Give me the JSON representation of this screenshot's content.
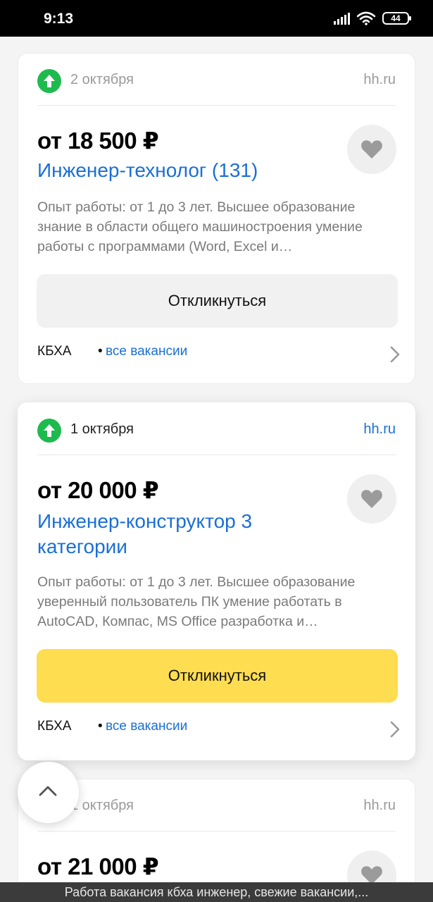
{
  "status_bar": {
    "time": "9:13",
    "battery": "44"
  },
  "cards": [
    {
      "date": "2 октября",
      "source": "hh.ru",
      "salary": "от 18 500 ₽",
      "title": "Инженер-технолог (131)",
      "description": "Опыт работы: от 1 до 3 лет. Высшее образование знание в области общего машиностроения умение работы с программами (Word, Excel и…",
      "apply_label": "Откликнуться",
      "company": "КБХА",
      "separator": "•",
      "all_vacancies": "все вакансии"
    },
    {
      "date": "1 октября",
      "source": "hh.ru",
      "salary": "от 20 000 ₽",
      "title": "Инженер-конструктор 3 категории",
      "description": "Опыт работы: от 1 до 3 лет. Высшее образование уверенный пользователь ПК умение работать в AutoCAD, Компас, MS Office разработка и…",
      "apply_label": "Откликнуться",
      "company": "КБХА",
      "separator": "•",
      "all_vacancies": "все вакансии"
    },
    {
      "date": "1 октября",
      "source": "hh.ru",
      "salary": "от 21 000 ₽"
    }
  ],
  "bottom_bar": {
    "text": "Работа вакансия кбха инженер, свежие вакансии,..."
  },
  "colors": {
    "accent_link": "#1a6fd6",
    "apply_highlight": "#ffdd50",
    "up_badge": "#1eba4e"
  }
}
